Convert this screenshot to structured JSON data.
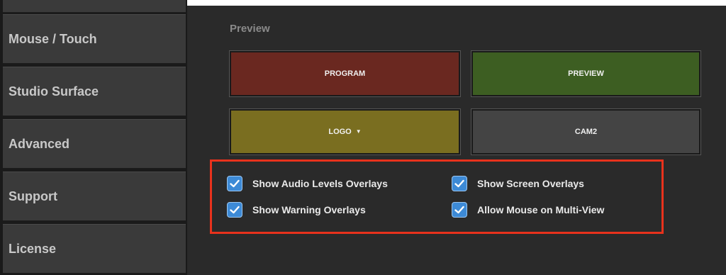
{
  "sidebar": {
    "items": [
      {
        "label": "Mouse / Touch"
      },
      {
        "label": "Studio Surface"
      },
      {
        "label": "Advanced"
      },
      {
        "label": "Support"
      },
      {
        "label": "License"
      }
    ]
  },
  "main": {
    "section_title": "Preview",
    "tiles": {
      "program": "PROGRAM",
      "preview": "PREVIEW",
      "logo": "LOGO",
      "cam2": "CAM2"
    },
    "options": [
      {
        "label": "Show Audio Levels Overlays",
        "checked": true
      },
      {
        "label": "Show Screen Overlays",
        "checked": true
      },
      {
        "label": "Show Warning Overlays",
        "checked": true
      },
      {
        "label": "Allow Mouse on Multi-View",
        "checked": true
      }
    ]
  },
  "colors": {
    "program": "#6a2820",
    "preview": "#3d5e22",
    "logo": "#7a6e20",
    "cam2": "#444444",
    "checkbox": "#3d8ad6",
    "highlight": "#e8321c"
  }
}
